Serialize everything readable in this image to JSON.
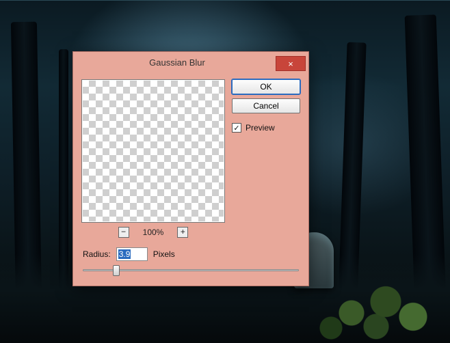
{
  "dialog": {
    "title": "Gaussian Blur",
    "close_icon": "×",
    "buttons": {
      "ok": "OK",
      "cancel": "Cancel"
    },
    "preview": {
      "checkbox_checked": "✓",
      "label": "Preview"
    },
    "zoom": {
      "minus": "−",
      "level": "100%",
      "plus": "+"
    },
    "radius": {
      "label": "Radius:",
      "value": "3.9",
      "unit": "Pixels",
      "slider_percent": 14
    }
  }
}
